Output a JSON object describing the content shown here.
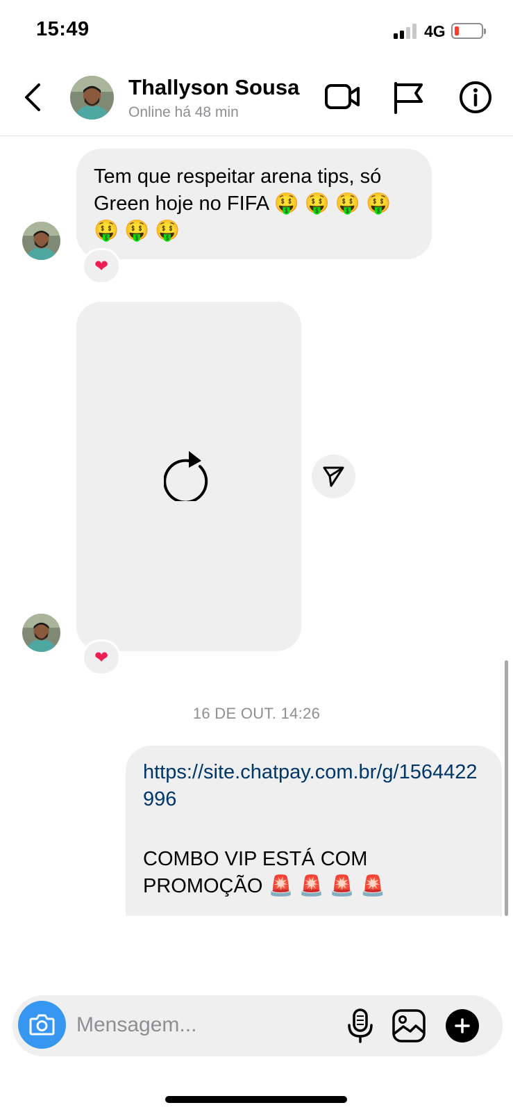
{
  "status_bar": {
    "time": "15:49",
    "network": "4G",
    "battery_level": 0.15,
    "battery_color": "#ff3b30"
  },
  "header": {
    "contact_name": "Thallyson Sousa",
    "contact_status": "Online há 48 min",
    "icons": [
      "back-arrow-icon",
      "video-call-icon",
      "flag-icon",
      "info-icon"
    ]
  },
  "messages": {
    "incoming_text": "Tem que respeitar arena tips, só Green hoje no FIFA 🤑 🤑 🤑 🤑\n🤑 🤑 🤑",
    "incoming_reaction": "❤",
    "video_reaction": "❤",
    "timestamp": "16 DE OUT. 14:26",
    "outgoing_link": "https://site.chatpay.com.br/g/1564422996",
    "outgoing_promo": "COMBO VIP ESTÁ COM\nPROMOÇÃO 🚨 🚨 🚨 🚨"
  },
  "composer": {
    "placeholder": "Mensagem...",
    "icons": [
      "camera-icon",
      "microphone-icon",
      "gallery-icon",
      "plus-icon"
    ]
  },
  "colors": {
    "bubble_bg": "#efefef",
    "link": "#00376b",
    "camera_button": "#3797f0",
    "reaction_heart": "#ee1d52",
    "secondary_text": "#8e8e93"
  }
}
